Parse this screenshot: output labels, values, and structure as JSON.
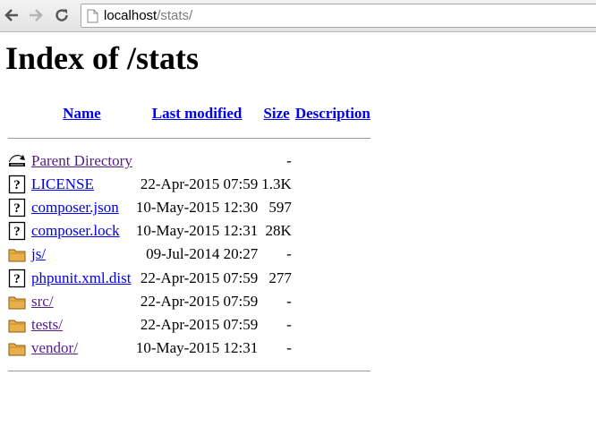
{
  "browser": {
    "url_host": "localhost",
    "url_path": "/stats/"
  },
  "page": {
    "title": "Index of /stats"
  },
  "table": {
    "headers": {
      "name": "Name",
      "last_modified": "Last modified",
      "size": "Size",
      "description": "Description"
    },
    "rows": [
      {
        "icon": "back-icon",
        "name": "Parent Directory",
        "date": "",
        "size": "-",
        "visited": true
      },
      {
        "icon": "unknown-file-icon",
        "name": "LICENSE",
        "date": "22-Apr-2015 07:59",
        "size": "1.3K",
        "visited": false
      },
      {
        "icon": "unknown-file-icon",
        "name": "composer.json",
        "date": "10-May-2015 12:30",
        "size": "597",
        "visited": false
      },
      {
        "icon": "unknown-file-icon",
        "name": "composer.lock",
        "date": "10-May-2015 12:31",
        "size": "28K",
        "visited": false
      },
      {
        "icon": "folder-icon",
        "name": "js/",
        "date": "09-Jul-2014 20:27",
        "size": "-",
        "visited": false
      },
      {
        "icon": "unknown-file-icon",
        "name": "phpunit.xml.dist",
        "date": "22-Apr-2015 07:59",
        "size": "277",
        "visited": false
      },
      {
        "icon": "folder-icon",
        "name": "src/",
        "date": "22-Apr-2015 07:59",
        "size": "-",
        "visited": true
      },
      {
        "icon": "folder-icon",
        "name": "tests/",
        "date": "22-Apr-2015 07:59",
        "size": "-",
        "visited": true
      },
      {
        "icon": "folder-icon",
        "name": "vendor/",
        "date": "10-May-2015 12:31",
        "size": "-",
        "visited": true
      }
    ]
  },
  "colors": {
    "link": "#0000ee",
    "visited_link": "#551a8b",
    "folder": "#e8b04a"
  }
}
